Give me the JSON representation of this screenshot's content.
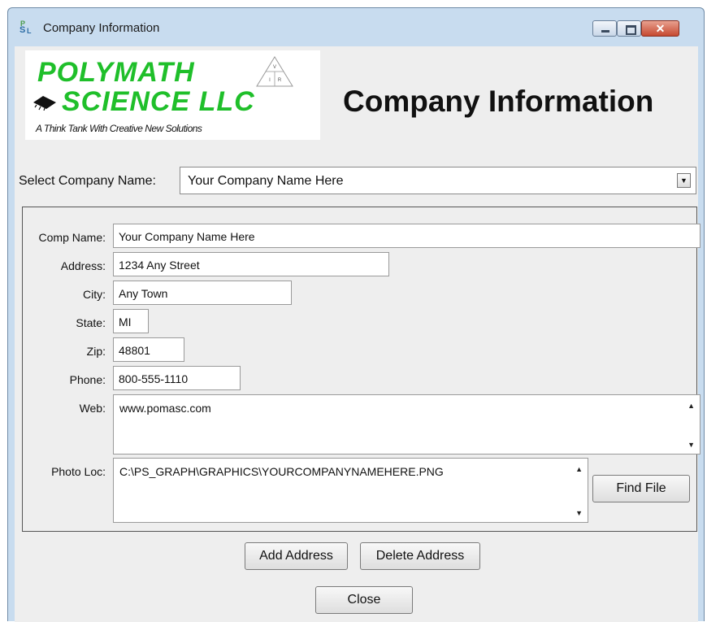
{
  "window": {
    "title": "Company Information",
    "minimize_glyph": "–",
    "maximize_glyph": "□",
    "close_glyph": "✕"
  },
  "logo": {
    "line1": "POLYMATH",
    "line2": "SCIENCE LLC",
    "tagline": "A Think Tank With Creative New Solutions"
  },
  "heading": "Company Information",
  "selector": {
    "label": "Select Company Name:",
    "value": "Your Company Name Here",
    "arrow_glyph": "▼"
  },
  "form": {
    "comp_name_label": "Comp Name:",
    "comp_name_value": "Your Company Name Here",
    "address_label": "Address:",
    "address_value": "1234 Any Street",
    "city_label": "City:",
    "city_value": "Any Town",
    "state_label": "State:",
    "state_value": "MI",
    "zip_label": "Zip:",
    "zip_value": "48801",
    "phone_label": "Phone:",
    "phone_value": "800-555-1110",
    "web_label": "Web:",
    "web_value": "www.pomasc.com",
    "photo_label": "Photo Loc:",
    "photo_value": "C:\\PS_GRAPH\\GRAPHICS\\YOURCOMPANYNAMEHERE.PNG"
  },
  "scroll": {
    "up_glyph": "▲",
    "down_glyph": "▼"
  },
  "buttons": {
    "find_file": "Find File",
    "add_address": "Add Address",
    "delete_address": "Delete Address",
    "close": "Close"
  },
  "colors": {
    "window_frame": "#c8dcef",
    "content_bg": "#eeeeee",
    "logo_green": "#1fbf2a",
    "close_red": "#c64a31"
  }
}
